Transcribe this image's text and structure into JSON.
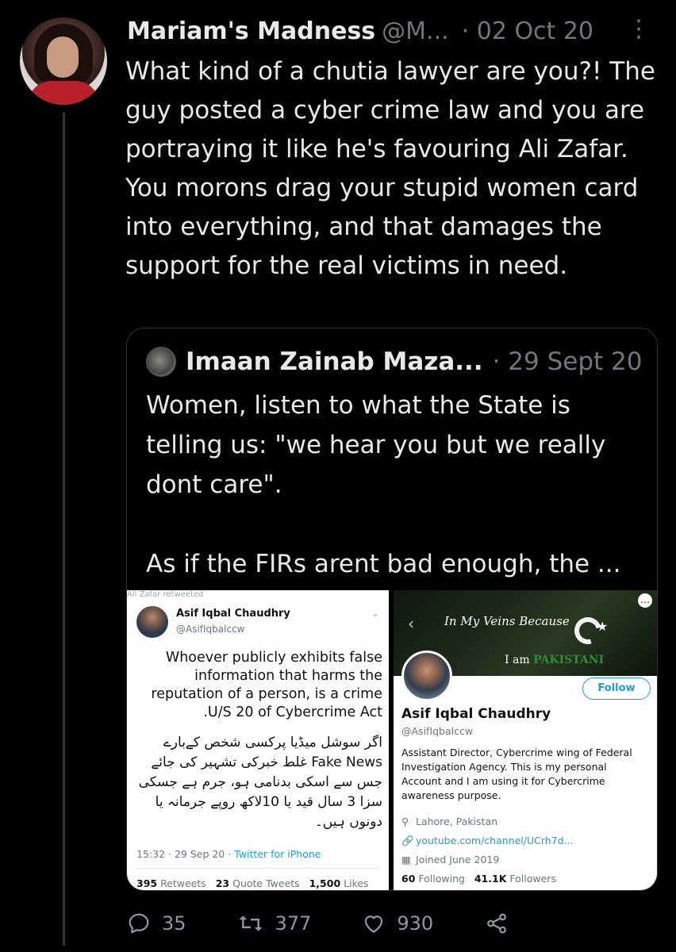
{
  "tweet": {
    "author_name": "Mariam's Madness",
    "handle": "@M...",
    "date": "· 02 Oct 20",
    "more_icon": "⋮",
    "text": "What kind of a chutia lawyer are you?! The guy posted a cyber crime law and you are portraying it like he's favouring Ali Zafar. You morons drag your stupid women card into everything, and that damages the support for the real victims in need."
  },
  "quote": {
    "author_name": "Imaan Zainab Maza...",
    "date": "· 29 Sept 20",
    "text_p1": "Women, listen to what the State is telling us: \"we hear you but we really dont care\".",
    "text_p2": "As if the FIRs arent bad enough, the ..."
  },
  "media_left": {
    "retweet_header": "Ali Zafar retweeted",
    "name": "Asif Iqbal Chaudhry",
    "handle": "@AsifIqbalccw",
    "text_en": "Whoever publicly exhibits false information that harms the reputation of a person, is a crime .U/S 20 of Cybercrime Act",
    "text_ur": "اگر سوشل میڈیا پرکسی شخص کےبارے Fake News غلط خبرکی تشہیر کی جائے جس سے اسکی بدنامی ہو، جرم ہے جسکی سزا 3 سال قید یا 10لاکھ روپے جرمانہ یا دونوں ہیں۔",
    "time": "15:32 · 29 Sep 20 ·",
    "source": "Twitter for iPhone",
    "retweets": "395",
    "retweets_label": "Retweets",
    "quotes": "23",
    "quotes_label": "Quote Tweets",
    "likes": "1,500",
    "likes_label": "Likes"
  },
  "media_right": {
    "banner_line1": "In My Veins Because",
    "banner_line2": "I am",
    "banner_pk": "PAKISTANI",
    "follow_label": "Follow",
    "name": "Asif Iqbal Chaudhry",
    "handle": "@AsifIqbalccw",
    "bio": "Assistant Director, Cybercrime wing of Federal Investigation Agency. This is my personal Account and I am using it for Cybercrime awareness purpose.",
    "location": "Lahore, Pakistan",
    "link": "youtube.com/channel/UCrh7d...",
    "joined": "Joined June 2019",
    "following": "60",
    "following_label": "Following",
    "followers": "41.1K",
    "followers_label": "Followers"
  },
  "actions": {
    "replies": "35",
    "retweets": "377",
    "likes": "930",
    "icons": [
      "reply-icon",
      "retweet-icon",
      "like-icon",
      "share-icon"
    ]
  },
  "colors": {
    "background": "#000000",
    "text": "#e7e9ea",
    "muted": "#71767b",
    "border": "#2f3336",
    "accent": "#1d9bf0"
  }
}
